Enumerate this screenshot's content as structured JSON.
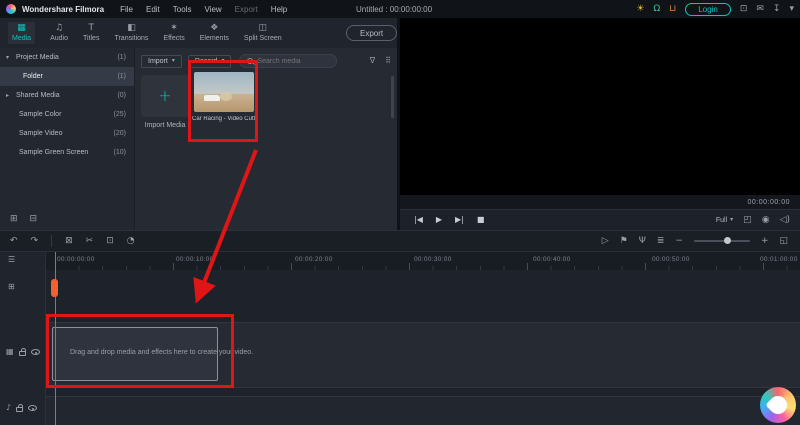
{
  "colors": {
    "accent": "#0bc5bd",
    "annotation": "#e01515",
    "playhead": "#f4602e"
  },
  "menubar": {
    "app_name": "Wondershare Filmora",
    "menus": [
      "File",
      "Edit",
      "Tools",
      "View",
      "Export",
      "Help"
    ],
    "project_title": "Untitled : 00:00:00:00",
    "login_label": "Login"
  },
  "tabbar": {
    "tabs": [
      {
        "label": "Media"
      },
      {
        "label": "Audio"
      },
      {
        "label": "Titles"
      },
      {
        "label": "Transitions"
      },
      {
        "label": "Effects"
      },
      {
        "label": "Elements"
      },
      {
        "label": "Split Screen"
      }
    ],
    "export_label": "Export"
  },
  "sidebar": {
    "items": [
      {
        "label": "Project Media",
        "count": "(1)"
      },
      {
        "label": "Folder",
        "count": "(1)"
      },
      {
        "label": "Shared Media",
        "count": "(0)"
      },
      {
        "label": "Sample Color",
        "count": "(25)"
      },
      {
        "label": "Sample Video",
        "count": "(20)"
      },
      {
        "label": "Sample Green Screen",
        "count": "(10)"
      }
    ]
  },
  "media_panel": {
    "import_button": "Import",
    "record_button": "Record",
    "search_placeholder": "Search media",
    "import_media_label": "Import Media",
    "clip_title": "Car Racing - Video Cutt..."
  },
  "preview": {
    "timecode": "00:00:00:00",
    "zoom_mode": "Full"
  },
  "timeline": {
    "ruler_labels": [
      "00:00:00:00",
      "00:00:10:00",
      "00:00:20:00",
      "00:00:30:00",
      "00:00:40:00",
      "00:00:50:00",
      "00:01:00:00"
    ],
    "placeholder_text": "Drag and drop media and effects here to create your video."
  },
  "icons": {
    "tip": "☀",
    "support": "Ω",
    "cart": "⊔",
    "screen": "⊡",
    "mail": "✉",
    "download": "↧",
    "collapse": "▾",
    "tab_media": "▦",
    "tab_audio": "♫",
    "tab_titles": "T",
    "tab_transitions": "◧",
    "tab_effects": "✶",
    "tab_elements": "❖",
    "tab_split": "◫",
    "chevron_down": "▾",
    "chevron_right": "▸",
    "filter": "∇",
    "grid": "⠿",
    "plus": "+",
    "new_folder": "⊞",
    "delete_folder": "⊟",
    "undo": "↶",
    "redo": "↷",
    "delete": "⊠",
    "split": "✂",
    "crop": "⊡",
    "speed": "◔",
    "render": "▷",
    "marker": "⚑",
    "voiceover": "Ψ",
    "mixer": "≣",
    "zoom_out": "−",
    "zoom_in": "+",
    "fit": "◱",
    "prev_frame": "|◀",
    "play": "▶",
    "next_frame": "▶|",
    "stop": "■",
    "fullscreen": "◰",
    "snapshot": "◉",
    "speaker": "◁)",
    "manage_tracks": "☰",
    "add_track": "⊞",
    "video_track": "▦",
    "audio_track": "♪"
  }
}
